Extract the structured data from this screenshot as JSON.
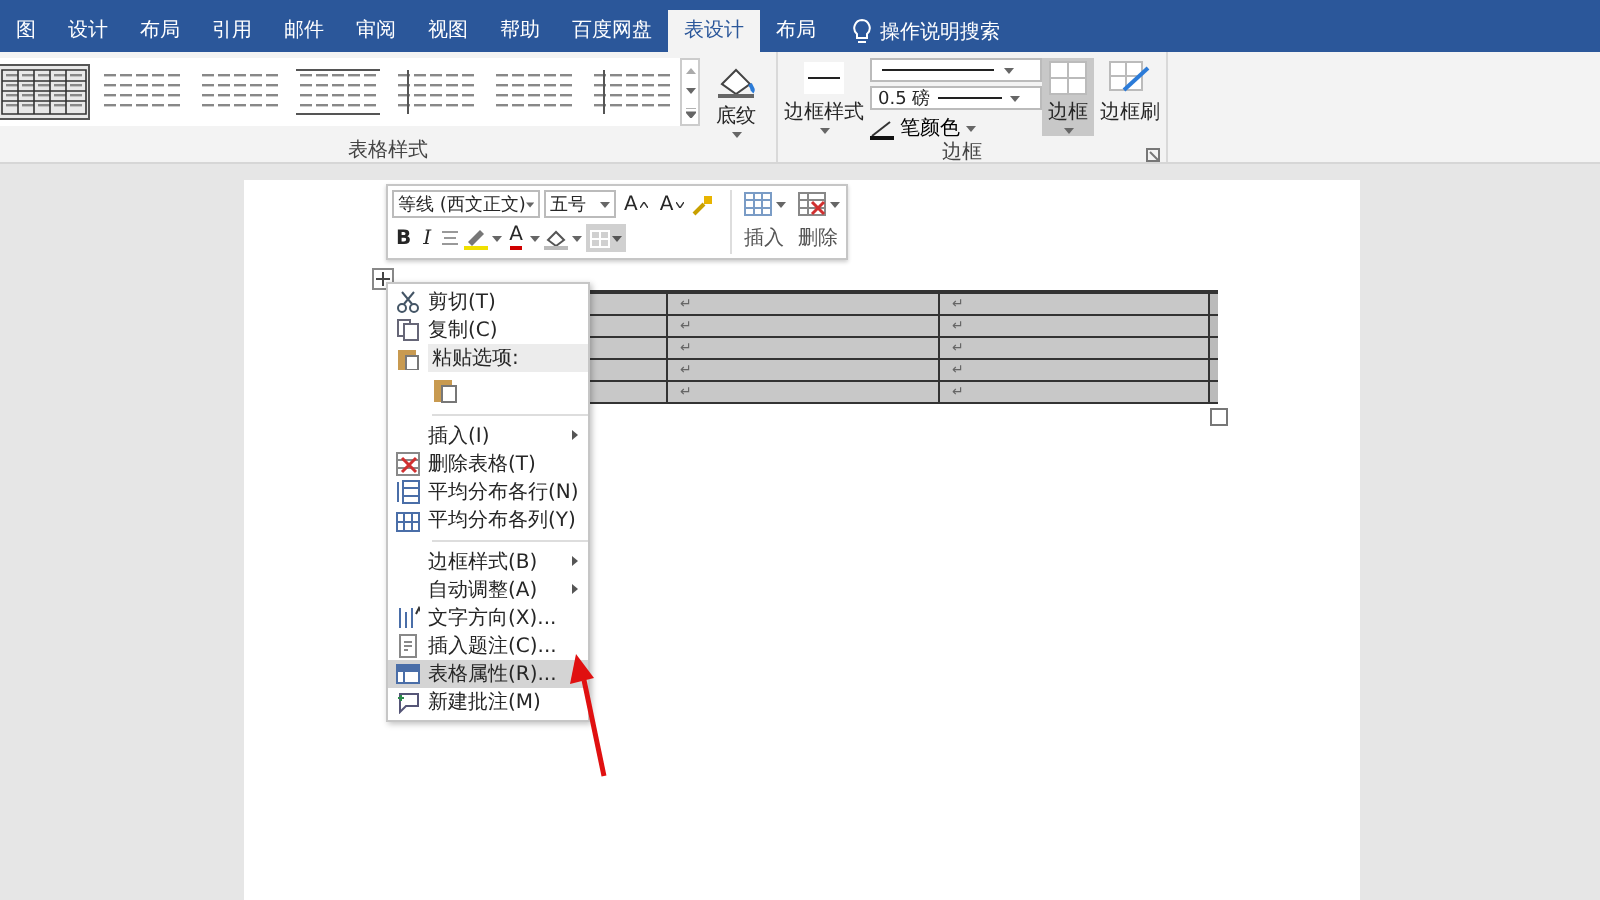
{
  "title_tabs": [
    {
      "label": "图",
      "selected": false
    },
    {
      "label": "设计",
      "selected": false
    },
    {
      "label": "布局",
      "selected": false
    },
    {
      "label": "引用",
      "selected": false
    },
    {
      "label": "邮件",
      "selected": false
    },
    {
      "label": "审阅",
      "selected": false
    },
    {
      "label": "视图",
      "selected": false
    },
    {
      "label": "帮助",
      "selected": false
    },
    {
      "label": "百度网盘",
      "selected": false
    },
    {
      "label": "表设计",
      "selected": true
    },
    {
      "label": "布局",
      "selected": false
    }
  ],
  "tell_me": "操作说明搜索",
  "ribbon": {
    "table_styles": {
      "label": "表格样式",
      "styles": [
        {
          "selected": true
        },
        {
          "selected": false
        },
        {
          "selected": false
        },
        {
          "selected": false
        },
        {
          "selected": false
        },
        {
          "selected": false
        },
        {
          "selected": false
        }
      ],
      "shading": "底纹"
    },
    "borders": {
      "label": "边框",
      "border_styles": "边框样式",
      "line_weight": "0.5 磅",
      "pen_color": "笔颜色",
      "borders_button": {
        "label": "边框",
        "selected": true
      },
      "border_painter": "边框刷"
    }
  },
  "mini_toolbar": {
    "font": "等线 (西文正文)",
    "size": "五号",
    "grow_font": "A",
    "shrink_font": "A",
    "bold": "B",
    "italic": "I",
    "font_color": "A",
    "insert": "插入",
    "delete": "删除"
  },
  "table": {
    "rows": [
      {
        "selected": true,
        "cells": [
          "↵",
          "↵"
        ]
      },
      {
        "selected": true,
        "cells": [
          "↵",
          "↵"
        ]
      },
      {
        "selected": true,
        "cells": [
          "↵",
          "↵"
        ]
      },
      {
        "selected": true,
        "cells": [
          "↵",
          "↵"
        ]
      },
      {
        "selected": true,
        "cells": [
          "↵",
          "↵"
        ]
      }
    ]
  },
  "context_menu": {
    "items": [
      {
        "kind": "item",
        "label": "剪切(T)",
        "selected": false
      },
      {
        "kind": "item",
        "label": "复制(C)",
        "selected": false
      },
      {
        "kind": "heading",
        "label": "粘贴选项:"
      },
      {
        "kind": "paste-options"
      },
      {
        "kind": "separator"
      },
      {
        "kind": "submenu",
        "label": "插入(I)",
        "selected": false
      },
      {
        "kind": "item",
        "label": "删除表格(T)",
        "selected": false
      },
      {
        "kind": "item",
        "label": "平均分布各行(N)",
        "selected": false
      },
      {
        "kind": "item",
        "label": "平均分布各列(Y)",
        "selected": false
      },
      {
        "kind": "separator"
      },
      {
        "kind": "submenu",
        "label": "边框样式(B)",
        "selected": false
      },
      {
        "kind": "submenu",
        "label": "自动调整(A)",
        "selected": false
      },
      {
        "kind": "item",
        "label": "文字方向(X)...",
        "selected": false
      },
      {
        "kind": "item",
        "label": "插入题注(C)...",
        "selected": false
      },
      {
        "kind": "item",
        "label": "表格属性(R)...",
        "selected": true
      },
      {
        "kind": "item",
        "label": "新建批注(M)",
        "selected": false
      }
    ]
  }
}
